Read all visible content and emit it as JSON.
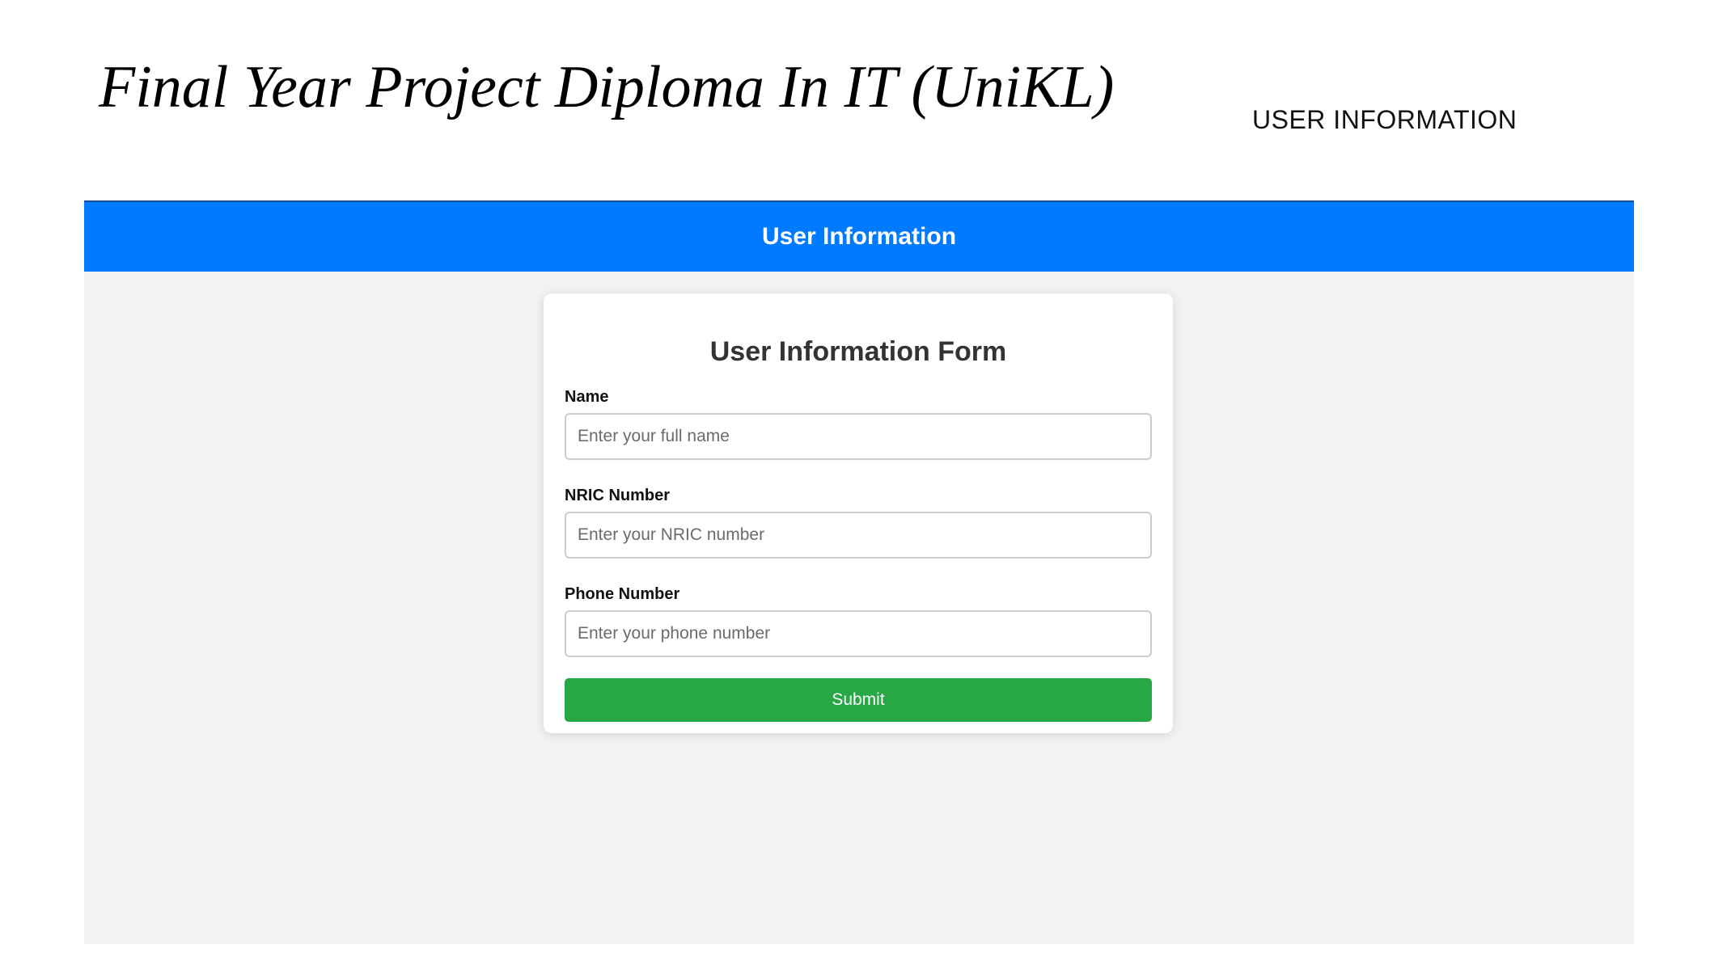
{
  "slide": {
    "title": "Final Year Project Diploma In IT (UniKL)",
    "subtitle": "USER INFORMATION"
  },
  "app": {
    "header_title": "User Information",
    "form": {
      "heading": "User Information Form",
      "fields": [
        {
          "label": "Name",
          "placeholder": "Enter your full name",
          "value": ""
        },
        {
          "label": "NRIC Number",
          "placeholder": "Enter your NRIC number",
          "value": ""
        },
        {
          "label": "Phone Number",
          "placeholder": "Enter your phone number",
          "value": ""
        }
      ],
      "submit_label": "Submit"
    }
  },
  "colors": {
    "header": "#007bff",
    "submit": "#28a745",
    "page_background": "#f2f2f2",
    "card_background": "#ffffff"
  }
}
